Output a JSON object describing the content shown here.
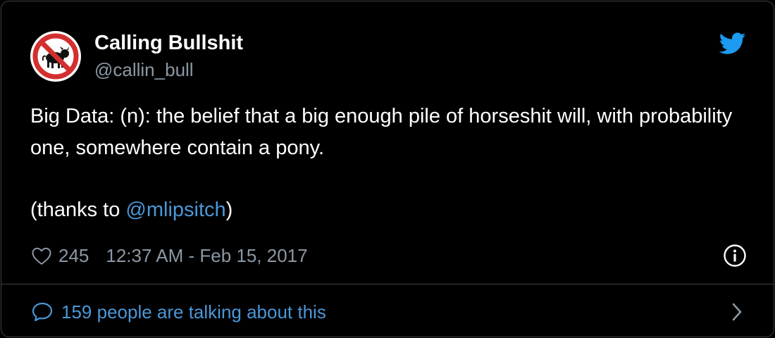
{
  "author": {
    "display_name": "Calling Bullshit",
    "handle": "@callin_bull",
    "avatar_icon": "no-bull-icon"
  },
  "tweet": {
    "line1": "Big Data: (n): the belief that a big enough pile of horseshit will, with probability one, somewhere contain a pony.",
    "thanks_prefix": "(thanks to ",
    "mention": "@mlipsitch",
    "thanks_suffix": ")"
  },
  "meta": {
    "like_count": "245",
    "timestamp": "12:37 AM - Feb 15, 2017"
  },
  "footer": {
    "conversation_text": "159 people are talking about this"
  },
  "colors": {
    "background": "#000000",
    "link": "#4a97d8",
    "muted": "#8b98a5",
    "twitter_blue": "#1d9bf0",
    "border": "#3d4247"
  }
}
